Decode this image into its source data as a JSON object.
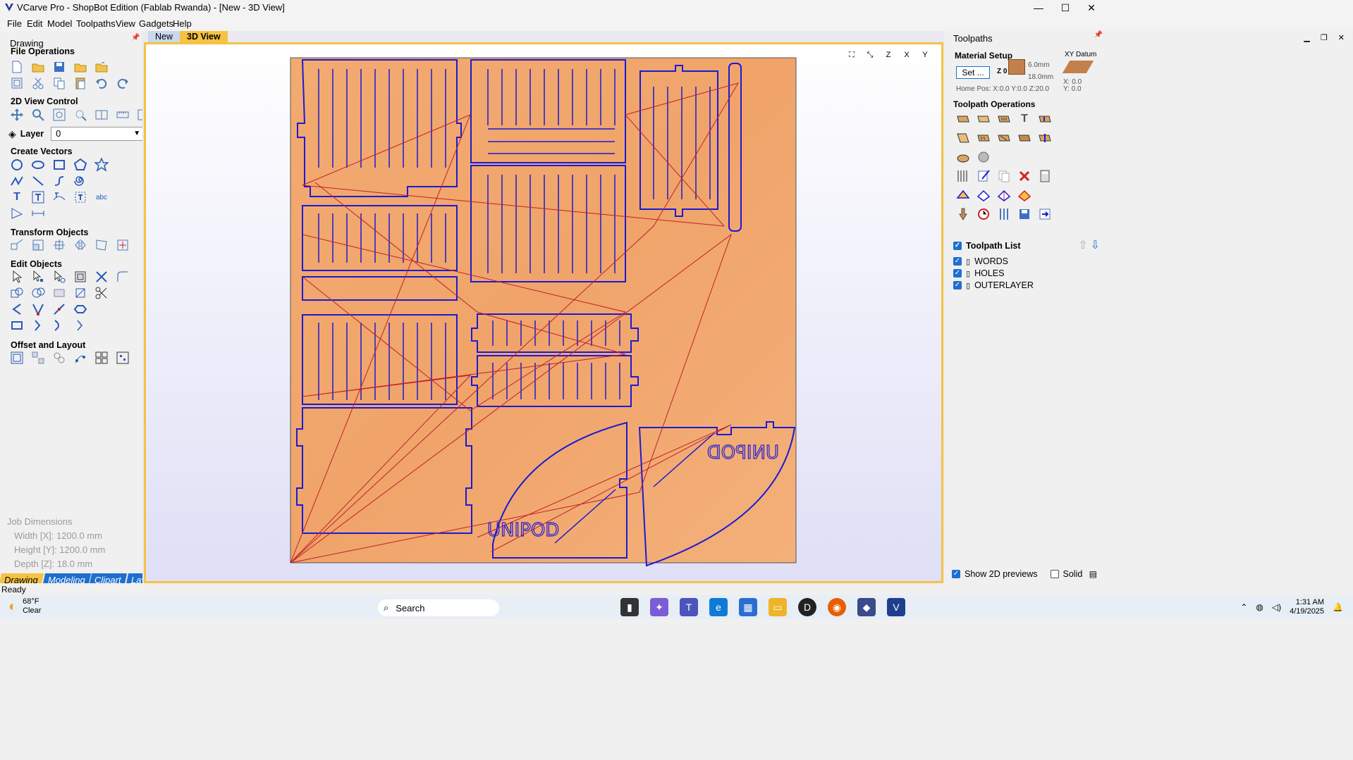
{
  "window": {
    "title": "VCarve Pro - ShopBot Edition (Fablab Rwanda) - [New - 3D View]",
    "controls": [
      "—",
      "☐",
      "✕"
    ]
  },
  "menu": [
    "File",
    "Edit",
    "Model",
    "Toolpaths",
    "View",
    "Gadgets",
    "Help"
  ],
  "left_panel": {
    "title": "Drawing",
    "sections": {
      "file_ops": "File Operations",
      "view_control": "2D View Control",
      "layer_label": "Layer",
      "layer_value": "0",
      "create_vectors": "Create Vectors",
      "transform": "Transform Objects",
      "edit": "Edit Objects",
      "offset": "Offset and Layout"
    },
    "job_dimensions": {
      "title": "Job Dimensions",
      "width": "Width  [X]: 1200.0 mm",
      "height": "Height [Y]: 1200.0 mm",
      "depth": "Depth  [Z]: 18.0 mm"
    },
    "tabs": [
      "Drawing",
      "Modeling",
      "Clipart",
      "Layers"
    ]
  },
  "document_tabs": [
    "New",
    "3D View"
  ],
  "view_icons": [
    "zoom-fit-icon",
    "iso-view-icon",
    "z-view-icon",
    "x-view-icon",
    "y-view-icon"
  ],
  "view_icon_labels": [
    "⛶",
    "⤡",
    "Z",
    "X",
    "Y"
  ],
  "canvas_text": {
    "word_left": "UNIPOD",
    "word_right": "UNIPOD"
  },
  "right_panel": {
    "title": "Toolpaths",
    "material_setup": "Material Setup",
    "set_button": "Set ...",
    "thickness_top": "6.0mm",
    "thickness_bottom": "18.0mm",
    "z0": "Z 0",
    "xy_datum": "XY Datum",
    "home_pos": "Home Pos:   X:0.0 Y:0.0 Z:20.0",
    "datum_x": "X: 0.0",
    "datum_y": "Y: 0.0",
    "toolpath_ops": "Toolpath Operations",
    "toolpath_list_title": "Toolpath List",
    "toolpaths": [
      "WORDS",
      "HOLES",
      "OUTERLAYER"
    ],
    "show_2d": "Show 2D previews",
    "solid": "Solid"
  },
  "status": "Ready",
  "taskbar": {
    "temp": "68°F",
    "condition": "Clear",
    "search": "Search",
    "time": "1:31 AM",
    "date": "4/19/2025"
  },
  "colors": {
    "accent": "#1e6fcf",
    "tab_active": "#f5c242",
    "wood": "#f0a46a",
    "vector": "#1a1ad6",
    "toolpath": "#c0202a"
  }
}
